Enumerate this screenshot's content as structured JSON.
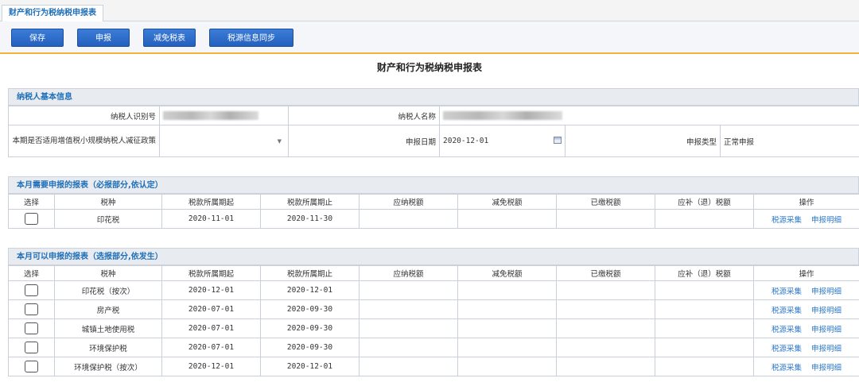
{
  "tab": {
    "label": "财产和行为税纳税申报表"
  },
  "toolbar": {
    "save": "保存",
    "declare": "申报",
    "reduce": "减免税表",
    "sync": "税源信息同步"
  },
  "page_title": "财产和行为税纳税申报表",
  "basic": {
    "header": "纳税人基本信息",
    "taxpayer_id_label": "纳税人识别号",
    "taxpayer_name_label": "纳税人名称",
    "policy_label": "本期是否适用增值税小规模纳税人减征政策",
    "policy_value": "",
    "declare_date_label": "申报日期",
    "declare_date_value": "2020-12-01",
    "declare_type_label": "申报类型",
    "declare_type_value": "正常申报",
    "dropdown_icon": "chevron-down-icon",
    "calendar_icon": "calendar-icon"
  },
  "columns": [
    "选择",
    "税种",
    "税款所属期起",
    "税款所属期止",
    "应纳税额",
    "减免税额",
    "已缴税额",
    "应补（退）税额",
    "操作"
  ],
  "actions": {
    "collect": "税源采集",
    "detail": "申报明细"
  },
  "required": {
    "header": "本月需要申报的报表（必报部分,依认定）",
    "rows": [
      {
        "tax": "印花税",
        "start": "2020-11-01",
        "end": "2020-11-30"
      }
    ]
  },
  "optional": {
    "header": "本月可以申报的报表（选报部分,依发生）",
    "rows": [
      {
        "tax": "印花税（按次）",
        "start": "2020-12-01",
        "end": "2020-12-01"
      },
      {
        "tax": "房产税",
        "start": "2020-07-01",
        "end": "2020-09-30"
      },
      {
        "tax": "城镇土地使用税",
        "start": "2020-07-01",
        "end": "2020-09-30"
      },
      {
        "tax": "环境保护税",
        "start": "2020-07-01",
        "end": "2020-09-30"
      },
      {
        "tax": "环境保护税（按次）",
        "start": "2020-12-01",
        "end": "2020-12-01"
      }
    ]
  }
}
